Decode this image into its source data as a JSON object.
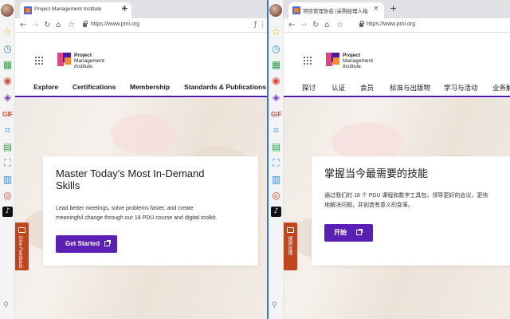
{
  "left": {
    "tab_title": "Project Management Institute",
    "url": "https://www.pmi.org",
    "logo": [
      "Project",
      "Management",
      "Institute."
    ],
    "nav": [
      "Explore",
      "Certifications",
      "Membership",
      "Standards & Publications"
    ],
    "hero_title_line1": "Master Today's Most In-Demand",
    "hero_title_line2": "Skills",
    "hero_text_line1": "Lead better meetings, solve problems faster, and create",
    "hero_text_line2": "meaningful change through our 18 PDU course and digital toolkit.",
    "cta": "Get Started",
    "feedback": "Give Feedback"
  },
  "right": {
    "tab_title": "项目管理协会 |采购经理人指数",
    "url": "https://www.pmi.org",
    "logo": [
      "Project",
      "Management",
      "Institute."
    ],
    "nav": [
      "探讨",
      "认证",
      "会员",
      "标准与出版物",
      "学习与活动",
      "业务解"
    ],
    "hero_title": "掌握当今最需要的技能",
    "hero_text_line1": "通过我们的 18 个 PDU 课程和数字工具包，领导更好的会议，更快",
    "hero_text_line2": "地解决问题，并创造有意义的变革。",
    "cta": "开始",
    "feedback": "提供反馈"
  },
  "icons": {
    "sidebar": [
      "star-icon",
      "clock-icon",
      "grid-icon",
      "record-icon",
      "ai-icon",
      "gif-icon",
      "crop-icon",
      "note-icon",
      "scan-icon",
      "doc-icon",
      "weibo-icon",
      "tiktok-icon"
    ],
    "colors": {
      "brand_purple": "#5a1fb4",
      "nav_underline": "#4f17a8",
      "feedback": "#c0461f",
      "divider": "#2b7be4"
    }
  }
}
